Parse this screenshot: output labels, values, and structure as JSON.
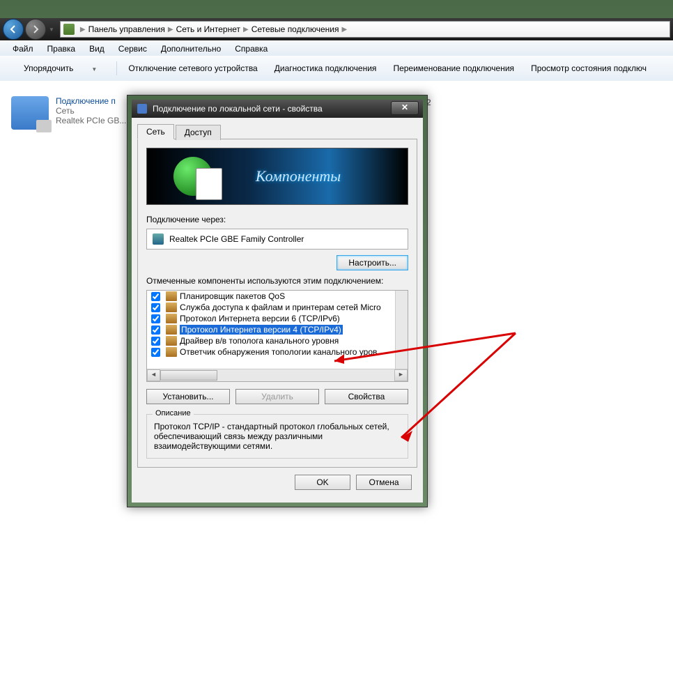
{
  "breadcrumb": {
    "root_icon": "control-panel",
    "items": [
      "Панель управления",
      "Сеть и Интернет",
      "Сетевые подключения"
    ]
  },
  "menu": {
    "file": "Файл",
    "edit": "Правка",
    "view": "Вид",
    "tools": "Сервис",
    "advanced": "Дополнительно",
    "help": "Справка"
  },
  "toolbar": {
    "organize": "Упорядочить",
    "disable": "Отключение сетевого устройства",
    "diagnose": "Диагностика подключения",
    "rename": "Переименование подключения",
    "status": "Просмотр состояния подключ"
  },
  "connection": {
    "name": "Подключение п",
    "net": "Сеть",
    "adapter": "Realtek PCIe GB..."
  },
  "bg_trail": " 2",
  "dialog": {
    "title": "Подключение по локальной сети - свойства",
    "tabs": {
      "net": "Сеть",
      "access": "Доступ"
    },
    "banner": "Компоненты",
    "connect_via": "Подключение через:",
    "adapter": "Realtek PCIe GBE Family Controller",
    "configure": "Настроить...",
    "components_label": "Отмеченные компоненты используются этим подключением:",
    "items": [
      "Планировщик пакетов QoS",
      "Служба доступа к файлам и принтерам сетей Micro",
      "Протокол Интернета версии 6 (TCP/IPv6)",
      "Протокол Интернета версии 4 (TCP/IPv4)",
      "Драйвер в/в тополога канального уровня",
      "Ответчик обнаружения топологии канального уров"
    ],
    "selected_index": 3,
    "install": "Установить...",
    "remove": "Удалить",
    "properties": "Свойства",
    "desc_title": "Описание",
    "desc": "Протокол TCP/IP - стандартный протокол глобальных сетей, обеспечивающий связь между различными взаимодействующими сетями.",
    "ok": "OK",
    "cancel": "Отмена"
  }
}
